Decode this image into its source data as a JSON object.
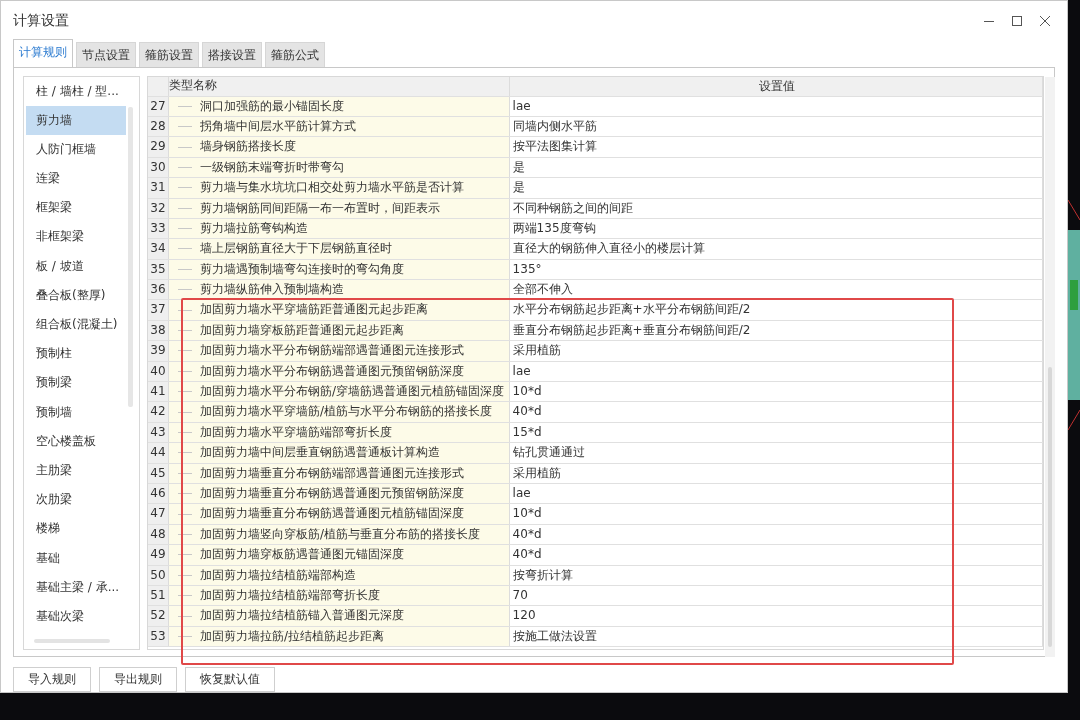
{
  "window": {
    "title": "计算设置"
  },
  "tabs": [
    {
      "label": "计算规则",
      "selected": true
    },
    {
      "label": "节点设置",
      "selected": false
    },
    {
      "label": "箍筋设置",
      "selected": false
    },
    {
      "label": "搭接设置",
      "selected": false
    },
    {
      "label": "箍筋公式",
      "selected": false
    }
  ],
  "sidebar": {
    "items": [
      {
        "label": "柱 / 墙柱 / 型...",
        "selected": false
      },
      {
        "label": "剪力墙",
        "selected": true
      },
      {
        "label": "人防门框墙",
        "selected": false
      },
      {
        "label": "连梁",
        "selected": false
      },
      {
        "label": "框架梁",
        "selected": false
      },
      {
        "label": "非框架梁",
        "selected": false
      },
      {
        "label": "板 / 坡道",
        "selected": false
      },
      {
        "label": "叠合板(整厚)",
        "selected": false
      },
      {
        "label": "组合板(混凝土)",
        "selected": false
      },
      {
        "label": "预制柱",
        "selected": false
      },
      {
        "label": "预制梁",
        "selected": false
      },
      {
        "label": "预制墙",
        "selected": false
      },
      {
        "label": "空心楼盖板",
        "selected": false
      },
      {
        "label": "主肋梁",
        "selected": false
      },
      {
        "label": "次肋梁",
        "selected": false
      },
      {
        "label": "楼梯",
        "selected": false
      },
      {
        "label": "基础",
        "selected": false
      },
      {
        "label": "基础主梁 / 承...",
        "selected": false
      },
      {
        "label": "基础次梁",
        "selected": false
      }
    ]
  },
  "table": {
    "columns": [
      "类型名称",
      "设置值"
    ],
    "row_groups": [
      {
        "highlighted": false,
        "rows": [
          {
            "number": "27",
            "name": "洞口加强筋的最小锚固长度",
            "value": "lae"
          },
          {
            "number": "28",
            "name": "拐角墙中间层水平筋计算方式",
            "value": "同墙内侧水平筋"
          },
          {
            "number": "29",
            "name": "墙身钢筋搭接长度",
            "value": "按平法图集计算"
          },
          {
            "number": "30",
            "name": "一级钢筋末端弯折时带弯勾",
            "value": "是"
          },
          {
            "number": "31",
            "name": "剪力墙与集水坑坑口相交处剪力墙水平筋是否计算",
            "value": "是"
          },
          {
            "number": "32",
            "name": "剪力墙钢筋同间距隔一布一布置时，间距表示",
            "value": "不同种钢筋之间的间距"
          },
          {
            "number": "33",
            "name": "剪力墙拉筋弯钩构造",
            "value": "两端135度弯钩"
          },
          {
            "number": "34",
            "name": "墙上层钢筋直径大于下层钢筋直径时",
            "value": "直径大的钢筋伸入直径小的楼层计算"
          },
          {
            "number": "35",
            "name": "剪力墙遇预制墙弯勾连接时的弯勾角度",
            "value": "135°"
          },
          {
            "number": "36",
            "name": "剪力墙纵筋伸入预制墙构造",
            "value": "全部不伸入"
          }
        ]
      },
      {
        "highlighted": true,
        "rows": [
          {
            "number": "37",
            "name": "加固剪力墙水平穿墙筋距普通图元起步距离",
            "value": "水平分布钢筋起步距离+水平分布钢筋间距/2"
          },
          {
            "number": "38",
            "name": "加固剪力墙穿板筋距普通图元起步距离",
            "value": "垂直分布钢筋起步距离+垂直分布钢筋间距/2"
          },
          {
            "number": "39",
            "name": "加固剪力墙水平分布钢筋端部遇普通图元连接形式",
            "value": "采用植筋"
          },
          {
            "number": "40",
            "name": "加固剪力墙水平分布钢筋遇普通图元预留钢筋深度",
            "value": "lae"
          },
          {
            "number": "41",
            "name": "加固剪力墙水平分布钢筋/穿墙筋遇普通图元植筋锚固深度",
            "value": "10*d"
          },
          {
            "number": "42",
            "name": "加固剪力墙水平穿墙筋/植筋与水平分布钢筋的搭接长度",
            "value": "40*d"
          },
          {
            "number": "43",
            "name": "加固剪力墙水平穿墙筋端部弯折长度",
            "value": "15*d"
          },
          {
            "number": "44",
            "name": "加固剪力墙中间层垂直钢筋遇普通板计算构造",
            "value": "钻孔贯通通过"
          },
          {
            "number": "45",
            "name": "加固剪力墙垂直分布钢筋端部遇普通图元连接形式",
            "value": "采用植筋"
          },
          {
            "number": "46",
            "name": "加固剪力墙垂直分布钢筋遇普通图元预留钢筋深度",
            "value": "lae"
          },
          {
            "number": "47",
            "name": "加固剪力墙垂直分布钢筋遇普通图元植筋锚固深度",
            "value": "10*d"
          },
          {
            "number": "48",
            "name": "加固剪力墙竖向穿板筋/植筋与垂直分布筋的搭接长度",
            "value": "40*d"
          },
          {
            "number": "49",
            "name": "加固剪力墙穿板筋遇普通图元锚固深度",
            "value": "40*d"
          },
          {
            "number": "50",
            "name": "加固剪力墙拉结植筋端部构造",
            "value": "按弯折计算"
          },
          {
            "number": "51",
            "name": "加固剪力墙拉结植筋端部弯折长度",
            "value": "70"
          },
          {
            "number": "52",
            "name": "加固剪力墙拉结植筋锚入普通图元深度",
            "value": "120"
          },
          {
            "number": "53",
            "name": "加固剪力墙拉筋/拉结植筋起步距离",
            "value": "按施工做法设置"
          }
        ]
      }
    ]
  },
  "buttons": [
    "导入规则",
    "导出规则",
    "恢复默认值"
  ]
}
